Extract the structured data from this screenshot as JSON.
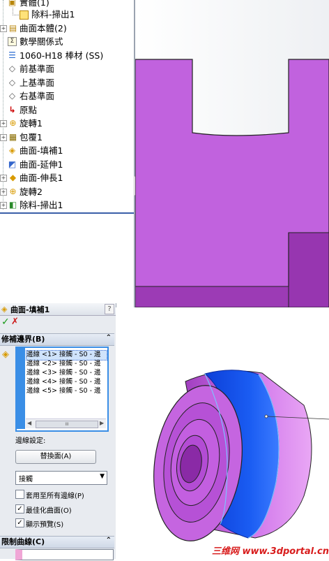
{
  "feature_tree": {
    "items": [
      {
        "label": "實體(1)",
        "expand": "",
        "icon": "solid-bodies-folder-icon"
      },
      {
        "label": "除料-掃出1",
        "expand": "",
        "icon": "cut-sweep-body-icon"
      },
      {
        "label": "曲面本體(2)",
        "expand": "+",
        "icon": "surface-bodies-folder-icon"
      },
      {
        "label": "數學關係式",
        "expand": "",
        "icon": "equations-icon"
      },
      {
        "label": "1060-H18 棒材 (SS)",
        "expand": "",
        "icon": "material-icon"
      },
      {
        "label": "前基準面",
        "expand": "",
        "icon": "plane-icon"
      },
      {
        "label": "上基準面",
        "expand": "",
        "icon": "plane-icon"
      },
      {
        "label": "右基準面",
        "expand": "",
        "icon": "plane-icon"
      },
      {
        "label": "原點",
        "expand": "",
        "icon": "origin-icon"
      },
      {
        "label": "旋轉1",
        "expand": "+",
        "icon": "revolve-icon"
      },
      {
        "label": "包覆1",
        "expand": "+",
        "icon": "wrap-icon"
      },
      {
        "label": "曲面-填補1",
        "expand": "",
        "icon": "filled-surface-icon"
      },
      {
        "label": "曲面-延伸1",
        "expand": "",
        "icon": "extend-surface-icon"
      },
      {
        "label": "曲面-伸長1",
        "expand": "+",
        "icon": "extruded-surface-icon"
      },
      {
        "label": "旋轉2",
        "expand": "+",
        "icon": "revolve-icon"
      },
      {
        "label": "除料-掃出1",
        "expand": "+",
        "icon": "cut-sweep-icon"
      }
    ]
  },
  "panel": {
    "title": "曲面-填補1",
    "help": "?",
    "ok": "✓",
    "cancel": "✗",
    "section_boundary": "修補邊界(B)",
    "section_collapse": "⌃",
    "edges": [
      "邊線 <1> 接觸 - S0 - 邊",
      "邊線 <2> 接觸 - S0 - 邊",
      "邊線 <3> 接觸 - S0 - 邊",
      "邊線 <4> 接觸 - S0 - 邊",
      "邊線 <5> 接觸 - S0 - 邊"
    ],
    "edge_settings_label": "邊線設定:",
    "swap_face_button": "替換面(A)",
    "condition_select": "接觸",
    "apply_all_label": "套用至所有邊線(P)",
    "apply_all_checked": false,
    "optimize_label": "最佳化曲面(O)",
    "optimize_checked": true,
    "preview_label": "顯示預覽(S)",
    "preview_checked": true,
    "section_constraint": "限制曲線(C)",
    "scroll_thumb": "III"
  },
  "watermark": "三维网 www.3dportal.cn",
  "colors": {
    "part_purple": "#c162de",
    "part_dark": "#9736b0",
    "fill_blue": "#1248e6",
    "tree_line": "#3a5fa8"
  }
}
